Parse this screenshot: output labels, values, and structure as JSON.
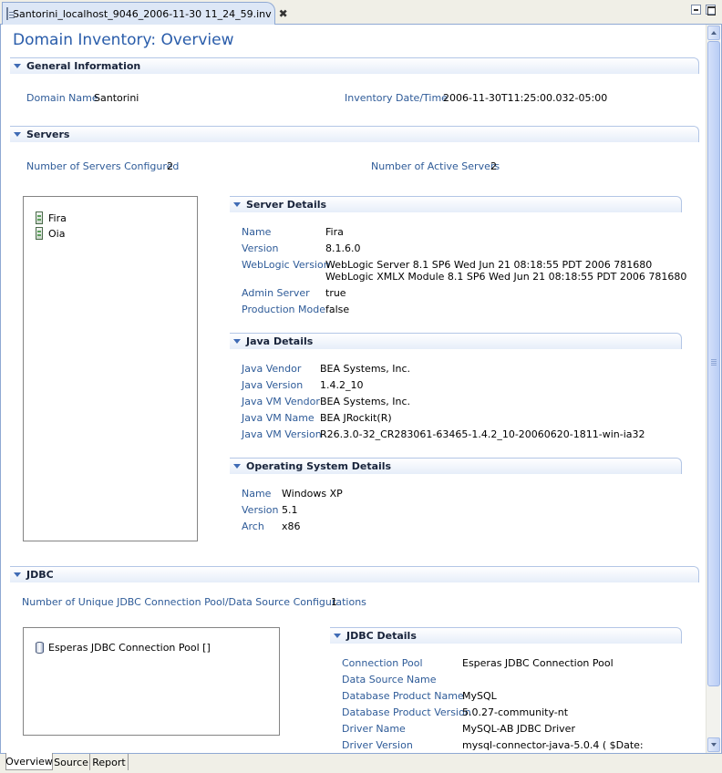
{
  "editor_tab": {
    "title": "Santorini_localhost_9046_2006-11-30 11_24_59.inv",
    "close": "✖"
  },
  "page_title": "Domain Inventory: Overview",
  "general": {
    "title": "General Information",
    "domain_name_label": "Domain Name",
    "domain_name": "Santorini",
    "inventory_date_label": "Inventory Date/Time",
    "inventory_date": "2006-11-30T11:25:00.032-05:00"
  },
  "servers": {
    "title": "Servers",
    "configured_label": "Number of Servers Configured",
    "configured": "2",
    "active_label": "Number of Active Servers",
    "active": "2",
    "tree": [
      "Fira",
      "Oia"
    ]
  },
  "server_details": {
    "title": "Server Details",
    "name_label": "Name",
    "name": "Fira",
    "version_label": "Version",
    "version": "8.1.6.0",
    "wl_version_label": "WebLogic Version",
    "wl_version_1": "WebLogic Server 8.1 SP6  Wed Jun 21 08:18:55 PDT 2006 781680",
    "wl_version_2": "WebLogic XMLX Module 8.1 SP6  Wed Jun 21 08:18:55 PDT 2006 781680",
    "admin_label": "Admin Server",
    "admin": "true",
    "prod_label": "Production Mode",
    "prod": "false"
  },
  "java_details": {
    "title": "Java Details",
    "vendor_label": "Java Vendor",
    "vendor": "BEA Systems, Inc.",
    "version_label": "Java Version",
    "version": "1.4.2_10",
    "vm_vendor_label": "Java VM Vendor",
    "vm_vendor": "BEA Systems, Inc.",
    "vm_name_label": "Java VM Name",
    "vm_name": "BEA JRockit(R)",
    "vm_version_label": "Java VM Version",
    "vm_version": "R26.3.0-32_CR283061-63465-1.4.2_10-20060620-1811-win-ia32"
  },
  "os_details": {
    "title": "Operating System Details",
    "name_label": "Name",
    "name": "Windows XP",
    "version_label": "Version",
    "version": "5.1",
    "arch_label": "Arch",
    "arch": "x86"
  },
  "jdbc": {
    "title": "JDBC",
    "unique_label": "Number of Unique JDBC Connection Pool/Data Source Configurations",
    "unique": "1",
    "tree": [
      "Esperas JDBC Connection Pool []"
    ]
  },
  "jdbc_details": {
    "title": "JDBC Details",
    "pool_label": "Connection Pool",
    "pool": "Esperas JDBC Connection Pool",
    "ds_label": "Data Source Name",
    "db_name_label": "Database Product Name",
    "db_name": "MySQL",
    "db_version_label": "Database Product Version",
    "db_version": "5.0.27-community-nt",
    "driver_name_label": "Driver Name",
    "driver_name": "MySQL-AB JDBC Driver",
    "driver_version_label": "Driver Version",
    "driver_version": "mysql-connector-java-5.0.4 ( $Date:"
  },
  "bottom_tabs": [
    "Overview",
    "Source",
    "Report"
  ],
  "icons": {
    "file": "file-icon",
    "close": "close-icon",
    "minimize": "minimize-icon",
    "maximize": "maximize-icon",
    "twisty": "chevron-down-icon",
    "server": "server-icon",
    "database": "database-icon"
  },
  "colors": {
    "title": "#295caa",
    "label": "#2e5b98",
    "section_border": "#b3c6e6",
    "tab_border": "#8fa9d3"
  }
}
